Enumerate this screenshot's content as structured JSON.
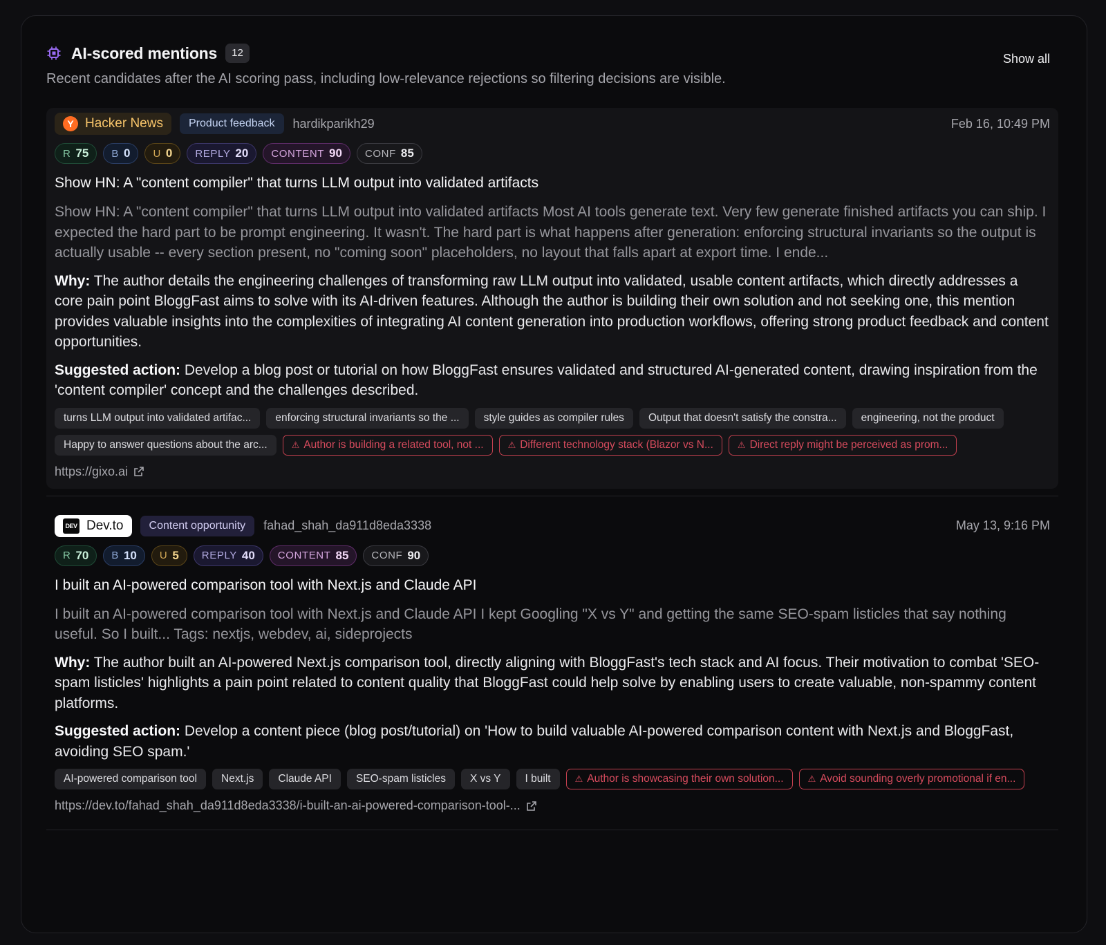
{
  "panel": {
    "title": "AI-scored mentions",
    "count": "12",
    "subtitle": "Recent candidates after the AI scoring pass, including low-relevance rejections so filtering decisions are visible.",
    "show_all": "Show all"
  },
  "labels": {
    "why": "Why:",
    "action": "Suggested action:"
  },
  "mentions": [
    {
      "source": "Hacker News",
      "source_logo": "Y",
      "category": "Product feedback",
      "author": "hardikparikh29",
      "date": "Feb 16, 10:49 PM",
      "scores": {
        "r_label": "R",
        "r": "75",
        "b_label": "B",
        "b": "0",
        "u_label": "U",
        "u": "0",
        "reply_label": "REPLY",
        "reply": "20",
        "content_label": "CONTENT",
        "content": "90",
        "conf_label": "CONF",
        "conf": "85"
      },
      "title": "Show HN: A \"content compiler\" that turns LLM output into validated artifacts",
      "excerpt": "Show HN: A \"content compiler\" that turns LLM output into validated artifacts Most AI tools generate text. Very few generate finished artifacts you can ship. I expected the hard part to be prompt engineering. It wasn't. The hard part is what happens after generation: enforcing structural invariants so the output is actually usable -- every section present, no \"coming soon\" placeholders, no layout that falls apart at export time. I ende...",
      "why": "The author details the engineering challenges of transforming raw LLM output into validated, usable content artifacts, which directly addresses a core pain point BloggFast aims to solve with its AI-driven features. Although the author is building their own solution and not seeking one, this mention provides valuable insights into the complexities of integrating AI content generation into production workflows, offering strong product feedback and content opportunities.",
      "action": "Develop a blog post or tutorial on how BloggFast ensures validated and structured AI-generated content, drawing inspiration from the 'content compiler' concept and the challenges described.",
      "tags": [
        "turns LLM output into validated artifac...",
        "enforcing structural invariants so the ...",
        "style guides as compiler rules",
        "Output that doesn't satisfy the constra...",
        "engineering, not the product",
        "Happy to answer questions about the arc..."
      ],
      "warnings": [
        "Author is building a related tool, not ...",
        "Different technology stack (Blazor vs N...",
        "Direct reply might be perceived as prom..."
      ],
      "url": "https://gixo.ai"
    },
    {
      "source": "Dev.to",
      "source_logo": "DEV",
      "category": "Content opportunity",
      "author": "fahad_shah_da911d8eda3338",
      "date": "May 13, 9:16 PM",
      "scores": {
        "r_label": "R",
        "r": "70",
        "b_label": "B",
        "b": "10",
        "u_label": "U",
        "u": "5",
        "reply_label": "REPLY",
        "reply": "40",
        "content_label": "CONTENT",
        "content": "85",
        "conf_label": "CONF",
        "conf": "90"
      },
      "title": "I built an AI-powered comparison tool with Next.js and Claude API",
      "excerpt": "I built an AI-powered comparison tool with Next.js and Claude API I kept Googling \"X vs Y\" and getting the same SEO-spam listicles that say nothing useful. So I built... Tags: nextjs, webdev, ai, sideprojects",
      "why": "The author built an AI-powered Next.js comparison tool, directly aligning with BloggFast's tech stack and AI focus. Their motivation to combat 'SEO-spam listicles' highlights a pain point related to content quality that BloggFast could help solve by enabling users to create valuable, non-spammy content platforms.",
      "action": "Develop a content piece (blog post/tutorial) on 'How to build valuable AI-powered comparison content with Next.js and BloggFast, avoiding SEO spam.'",
      "tags": [
        "AI-powered comparison tool",
        "Next.js",
        "Claude API",
        "SEO-spam listicles",
        "X vs Y",
        "I built"
      ],
      "warnings": [
        "Author is showcasing their own solution...",
        "Avoid sounding overly promotional if en..."
      ],
      "url": "https://dev.to/fahad_shah_da911d8eda3338/i-built-an-ai-powered-comparison-tool-..."
    }
  ]
}
